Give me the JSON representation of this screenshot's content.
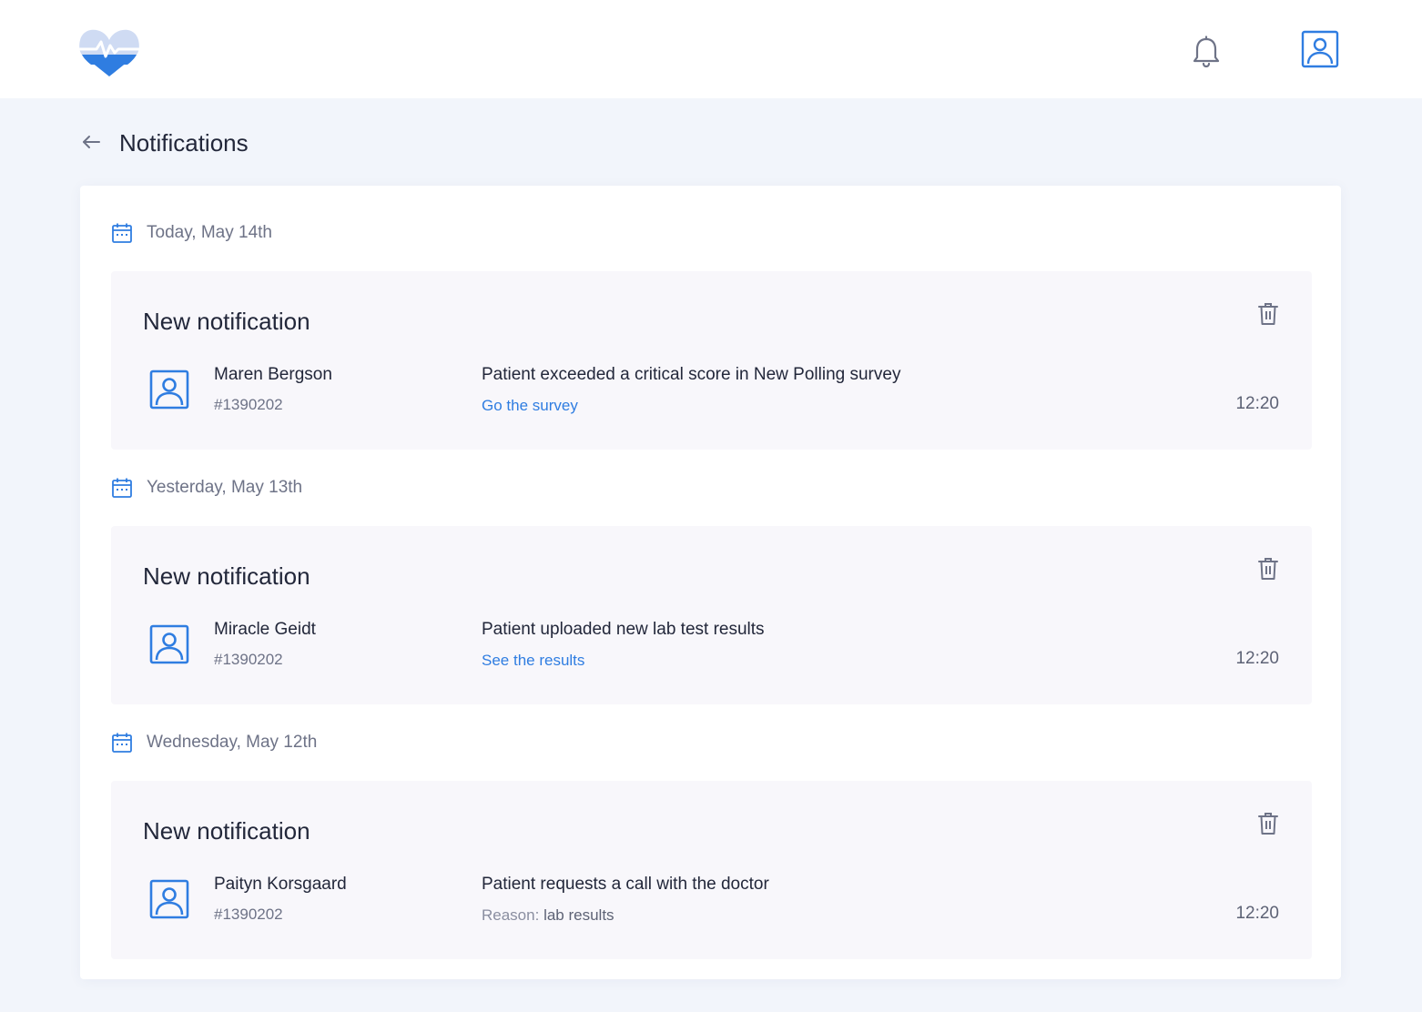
{
  "header": {
    "logo_icon": "heartbeat-heart-logo",
    "bell_icon": "bell-icon",
    "profile_icon": "user-profile-icon"
  },
  "page": {
    "title": "Notifications"
  },
  "colors": {
    "accent": "#2f7de1",
    "background": "#f2f5fb",
    "card": "#f8f7fb"
  },
  "groups": [
    {
      "date": "Today, May 14th",
      "notification": {
        "title": "New notification",
        "patient_name": "Maren Bergson",
        "patient_id": "#1390202",
        "message": "Patient exceeded a critical score in New Polling survey",
        "link": "Go the survey",
        "time": "12:20"
      }
    },
    {
      "date": "Yesterday, May 13th",
      "notification": {
        "title": "New notification",
        "patient_name": "Miracle Geidt",
        "patient_id": "#1390202",
        "message": "Patient uploaded new lab test results",
        "link": "See the results",
        "time": "12:20"
      }
    },
    {
      "date": "Wednesday, May 12th",
      "notification": {
        "title": "New notification",
        "patient_name": "Paityn Korsgaard",
        "patient_id": "#1390202",
        "message": "Patient requests a call with the doctor",
        "reason_label": "Reason:",
        "reason_value": "lab results",
        "time": "12:20"
      }
    }
  ]
}
